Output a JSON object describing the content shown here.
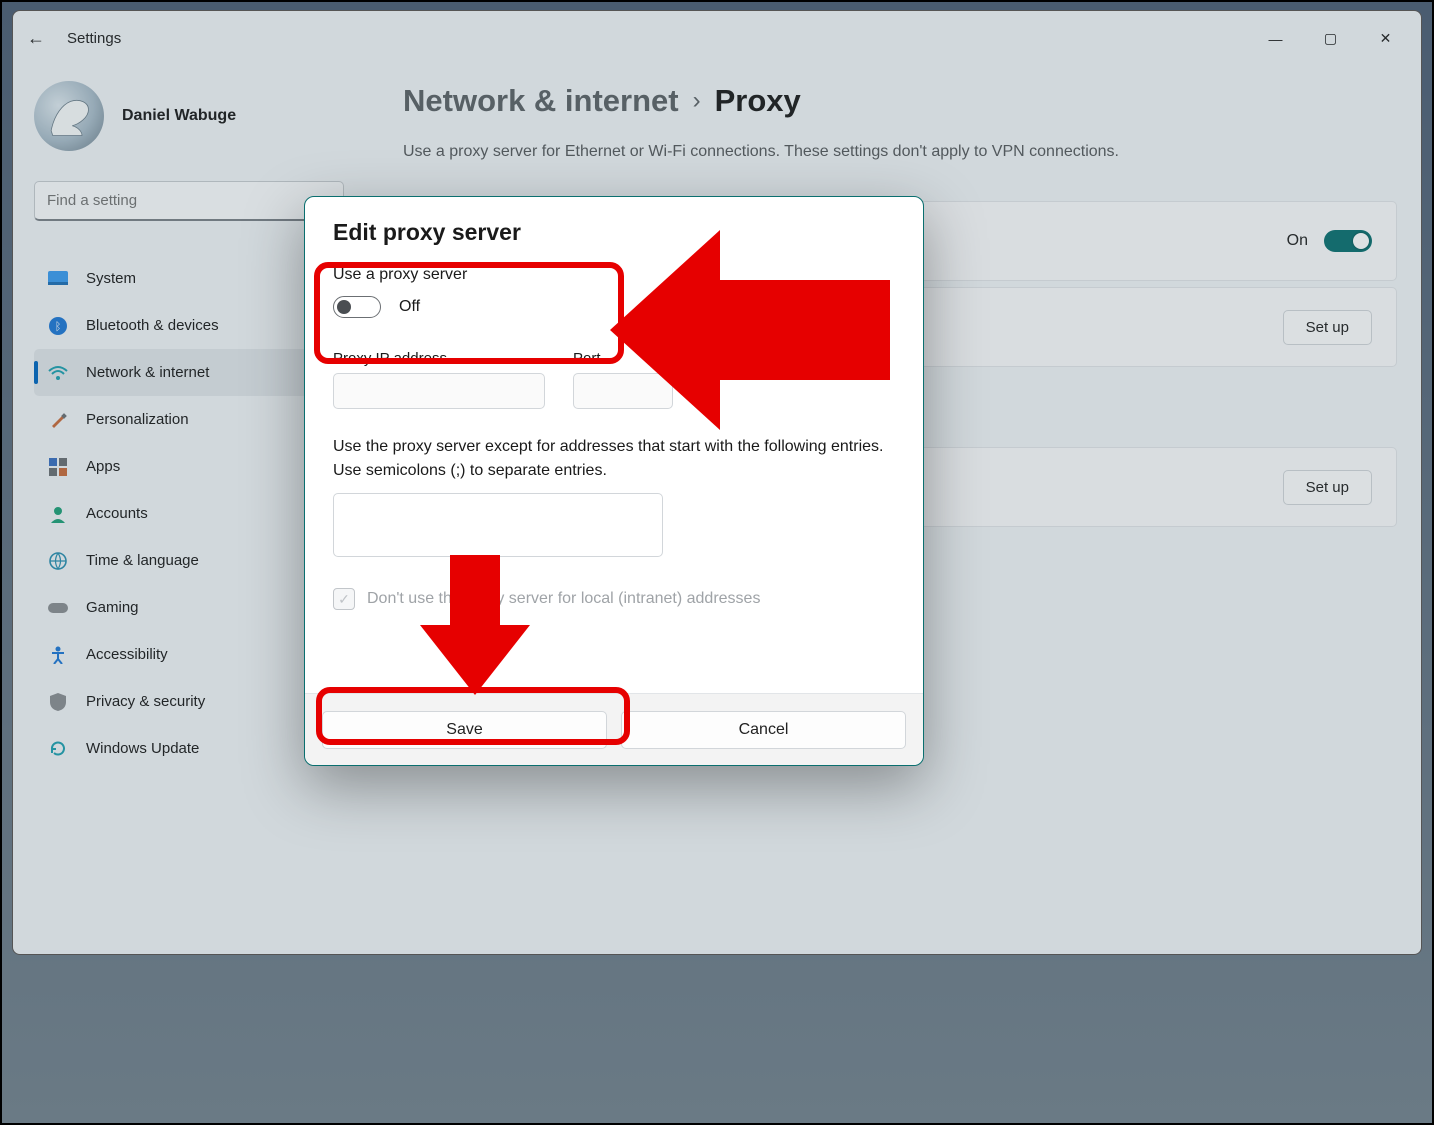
{
  "window": {
    "title": "Settings"
  },
  "user": {
    "name": "Daniel Wabuge"
  },
  "search": {
    "placeholder": "Find a setting"
  },
  "nav": {
    "items": [
      {
        "label": "System"
      },
      {
        "label": "Bluetooth & devices"
      },
      {
        "label": "Network & internet"
      },
      {
        "label": "Personalization"
      },
      {
        "label": "Apps"
      },
      {
        "label": "Accounts"
      },
      {
        "label": "Time & language"
      },
      {
        "label": "Gaming"
      },
      {
        "label": "Accessibility"
      },
      {
        "label": "Privacy & security"
      },
      {
        "label": "Windows Update"
      }
    ]
  },
  "breadcrumb": {
    "parent": "Network & internet",
    "separator": "›",
    "current": "Proxy"
  },
  "page": {
    "description": "Use a proxy server for Ethernet or Wi-Fi connections. These settings don't apply to VPN connections."
  },
  "cards": {
    "detect": {
      "status": "On"
    },
    "setup1": {
      "button": "Set up"
    },
    "setup2": {
      "button": "Set up"
    }
  },
  "dialog": {
    "title": "Edit proxy server",
    "useProxyLabel": "Use a proxy server",
    "toggleState": "Off",
    "ipLabel": "Proxy IP address",
    "portLabel": "Port",
    "exceptText1": "Use the proxy server except for addresses that start with the following entries.",
    "exceptText2": "Use semicolons (;) to separate entries.",
    "localCheckbox": "Don't use the proxy server for local (intranet) addresses",
    "save": "Save",
    "cancel": "Cancel"
  },
  "colors": {
    "accent": "#0067c0",
    "teal": "#0a6f6f",
    "annotation": "#e60000"
  }
}
